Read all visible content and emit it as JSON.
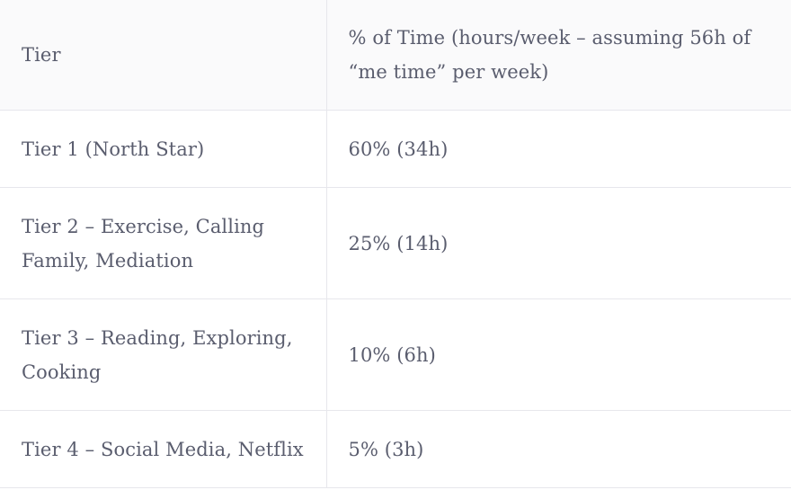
{
  "table": {
    "header": {
      "tier": "Tier",
      "time": "% of Time (hours/week – assuming 56h of “me time” per week)"
    },
    "rows": [
      {
        "tier": "Tier 1 (North Star)",
        "time": "60% (34h)"
      },
      {
        "tier": "Tier 2 – Exercise, Calling Family, Mediation",
        "time": "25% (14h)"
      },
      {
        "tier": "Tier 3 – Reading, Exploring, Cooking",
        "time": "10% (6h)"
      },
      {
        "tier": "Tier 4 – Social Media, Netflix",
        "time": "5% (3h)"
      }
    ]
  },
  "colors": {
    "text": "#5a5d6e",
    "border": "#e7e7ec",
    "header_bg": "#fafafb"
  }
}
